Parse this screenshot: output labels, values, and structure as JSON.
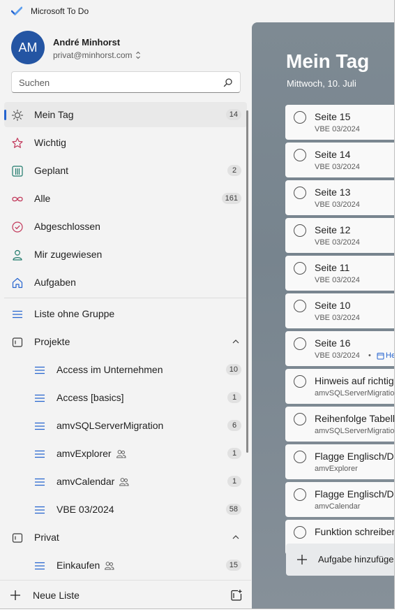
{
  "app": {
    "title": "Microsoft To Do"
  },
  "user": {
    "initials": "AM",
    "name": "André Minhorst",
    "email": "privat@minhorst.com"
  },
  "search": {
    "placeholder": "Suchen"
  },
  "nav": [
    {
      "label": "Mein Tag",
      "count": "14",
      "icon": "sun-icon",
      "active": true
    },
    {
      "label": "Wichtig",
      "count": "",
      "icon": "star-icon"
    },
    {
      "label": "Geplant",
      "count": "2",
      "icon": "calendar-grid-icon"
    },
    {
      "label": "Alle",
      "count": "161",
      "icon": "infinity-icon"
    },
    {
      "label": "Abgeschlossen",
      "count": "",
      "icon": "check-circle-icon"
    },
    {
      "label": "Mir zugewiesen",
      "count": "",
      "icon": "person-icon"
    },
    {
      "label": "Aufgaben",
      "count": "",
      "icon": "home-icon"
    }
  ],
  "lists": {
    "ungrouped": {
      "label": "Liste ohne Gruppe"
    },
    "projects_group": {
      "label": "Projekte"
    },
    "projects": [
      {
        "label": "Access im Unternehmen",
        "count": "10",
        "shared": false
      },
      {
        "label": "Access [basics]",
        "count": "1",
        "shared": false
      },
      {
        "label": "amvSQLServerMigration",
        "count": "6",
        "shared": false
      },
      {
        "label": "amvExplorer",
        "count": "1",
        "shared": true
      },
      {
        "label": "amvCalendar",
        "count": "1",
        "shared": true
      },
      {
        "label": "VBE 03/2024",
        "count": "58",
        "shared": false
      }
    ],
    "private_group": {
      "label": "Privat"
    },
    "private": [
      {
        "label": "Einkaufen",
        "count": "15",
        "shared": true
      }
    ]
  },
  "footer": {
    "new_list_label": "Neue Liste"
  },
  "main": {
    "title": "Mein Tag",
    "date": "Mittwoch, 10. Juli",
    "tasks": [
      {
        "title": "Seite 15",
        "sub": "VBE 03/2024"
      },
      {
        "title": "Seite 14",
        "sub": "VBE 03/2024"
      },
      {
        "title": "Seite 13",
        "sub": "VBE 03/2024"
      },
      {
        "title": "Seite 12",
        "sub": "VBE 03/2024"
      },
      {
        "title": "Seite 11",
        "sub": "VBE 03/2024"
      },
      {
        "title": "Seite 10",
        "sub": "VBE 03/2024"
      },
      {
        "title": "Seite 16",
        "sub": "VBE 03/2024",
        "extra": "Heu"
      },
      {
        "title": "Hinweis auf richtige",
        "sub": "amvSQLServerMigration"
      },
      {
        "title": "Reihenfolge Tabellen",
        "sub": "amvSQLServerMigration"
      },
      {
        "title": "Flagge Englisch/Deutsch",
        "sub": "amvExplorer"
      },
      {
        "title": "Flagge Englisch/Deutsch",
        "sub": "amvCalendar"
      },
      {
        "title": "Funktion schreiben",
        "sub": ""
      }
    ],
    "add_task_label": "Aufgabe hinzufügen"
  },
  "colors": {
    "accent": "#2564cf",
    "avatar_bg": "#2455a3"
  }
}
